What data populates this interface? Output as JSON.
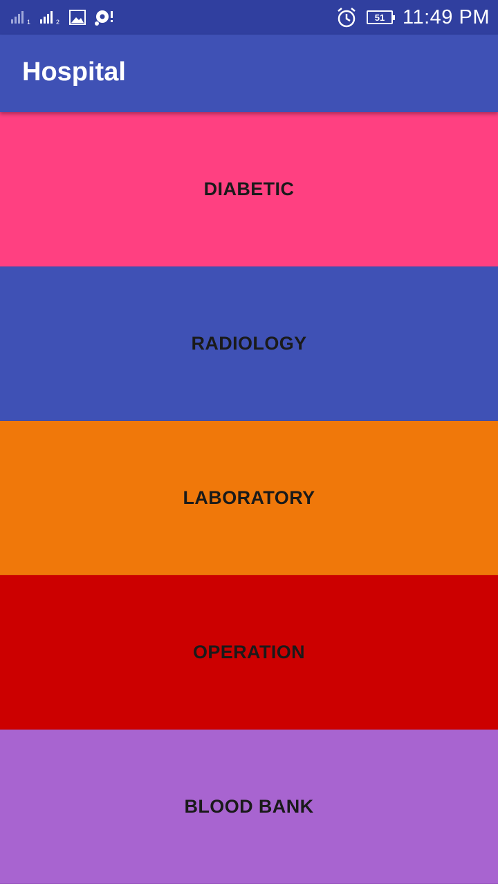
{
  "status_bar": {
    "time": "11:49 PM",
    "battery_level": "51",
    "sim1_label": "1",
    "sim2_label": "2",
    "icons": [
      "signal-sim1-icon",
      "signal-sim2-icon",
      "gallery-icon",
      "vpn-icon",
      "alarm-icon",
      "battery-icon"
    ],
    "color": "#303F9F"
  },
  "app_bar": {
    "title": "Hospital",
    "color": "#3F51B5"
  },
  "menu": {
    "items": [
      {
        "label": "DIABETIC",
        "color": "#FF4081"
      },
      {
        "label": "RADIOLOGY",
        "color": "#3F51B5"
      },
      {
        "label": "LABORATORY",
        "color": "#F0780A"
      },
      {
        "label": "OPERATION",
        "color": "#CC0000"
      },
      {
        "label": "BLOOD BANK",
        "color": "#A864D0"
      }
    ]
  }
}
